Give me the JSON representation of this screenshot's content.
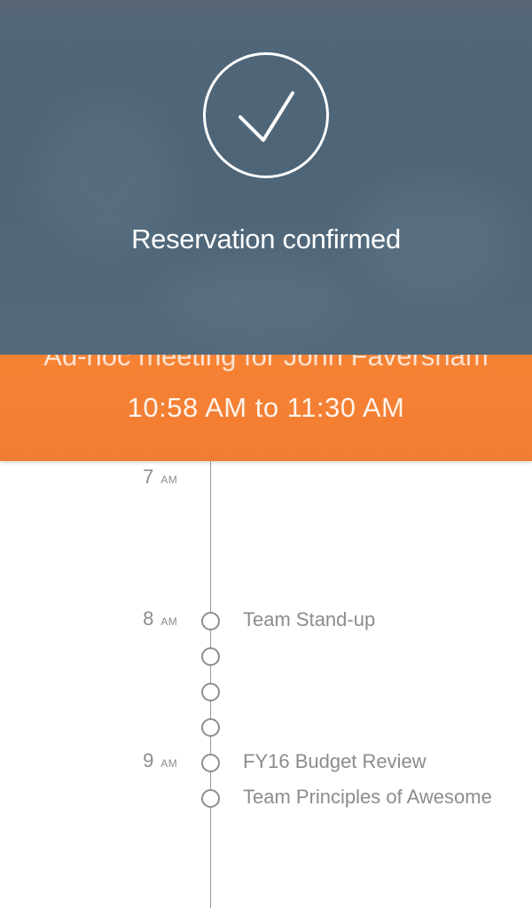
{
  "confirmation": {
    "title": "Reservation confirmed",
    "icon": "checkmark-icon"
  },
  "meeting": {
    "title": "Ad-hoc meeting for John Faversham",
    "time": "10:58 AM to 11:30 AM"
  },
  "timeline": {
    "hours": [
      {
        "num": "7",
        "ampm": "AM"
      },
      {
        "num": "8",
        "ampm": "AM"
      },
      {
        "num": "9",
        "ampm": "AM"
      }
    ],
    "events": [
      {
        "label": "Team Stand-up"
      },
      {
        "label": "FY16 Budget Review"
      },
      {
        "label": "Team Principles of Awesome"
      }
    ]
  },
  "colors": {
    "header_background": "#4e6577",
    "meeting_band": "#f5802f",
    "timeline_text": "#8c8c8c"
  }
}
